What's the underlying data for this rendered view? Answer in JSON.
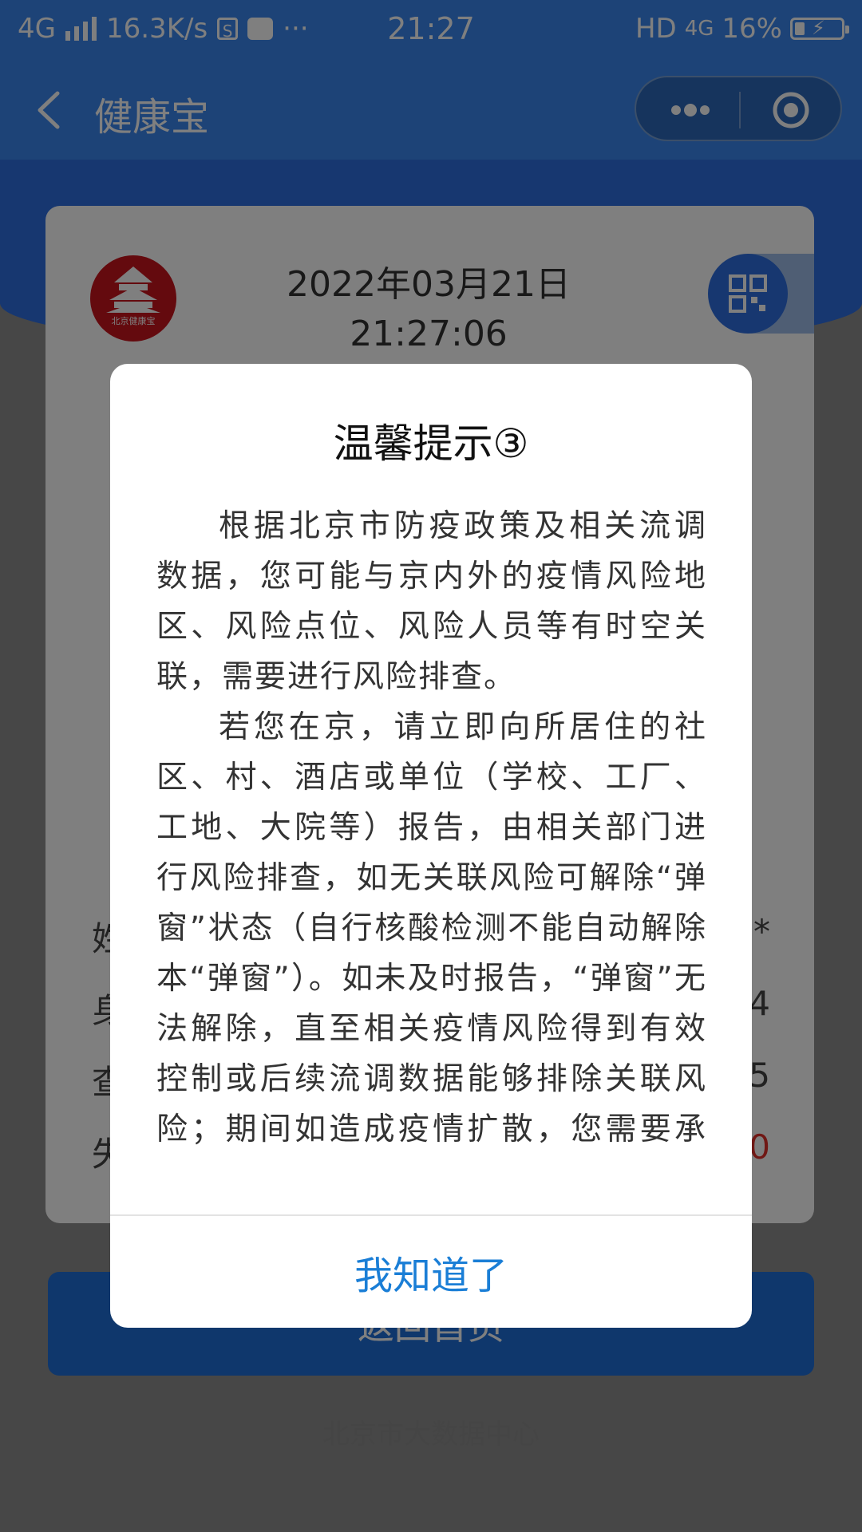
{
  "status_bar": {
    "network_left": "4G",
    "speed": "16.3K/s",
    "app_badge_icon": "S",
    "more": "···",
    "time": "21:27",
    "hd": "HD",
    "network_right": "4G",
    "battery": "16%"
  },
  "nav": {
    "title": "健康宝"
  },
  "card": {
    "logo_text": "北京健康宝",
    "date": "2022年03月21日",
    "time": "21:27:06",
    "rows": [
      {
        "label": "姓",
        "value": "*"
      },
      {
        "label": "身",
        "value": "4"
      },
      {
        "label": "查",
        "value": "5"
      },
      {
        "label": "失",
        "value": "0"
      }
    ]
  },
  "home_button": {
    "label": "返回首页"
  },
  "footer": {
    "text": "北京市大数据中心"
  },
  "dialog": {
    "title": "温馨提示③",
    "paragraphs": [
      "根据北京市防疫政策及相关流调数据，您可能与京内外的疫情风险地区、风险点位、风险人员等有时空关联，需要进行风险排查。",
      "若您在京，请立即向所居住的社区、村、酒店或单位（学校、工厂、工地、大院等）报告，由相关部门进行风险排查，如无关联风险可解除“弹窗”状态（自行核酸检测不能自动解除本“弹窗”）。如未及时报告，“弹窗”无法解除，直至相关疫情风险得到有效控制或后续流调数据能够排除关联风险；期间如造成疫情扩散，您需要承担防疫相关法律责"
    ],
    "confirm_label": "我知道了"
  },
  "colors": {
    "brand_blue": "#3a87ef",
    "confirm_blue": "#1a7ed6",
    "logo_red": "#c8141d",
    "alert_red": "#e0302a"
  }
}
